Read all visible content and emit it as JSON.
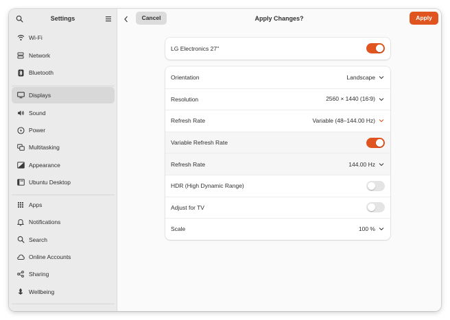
{
  "sidebar": {
    "title": "Settings",
    "search_icon": "search-icon",
    "menu_icon": "hamburger-menu-icon",
    "items": [
      {
        "label": "Wi-Fi",
        "icon": "wifi-icon"
      },
      {
        "label": "Network",
        "icon": "network-icon"
      },
      {
        "label": "Bluetooth",
        "icon": "bluetooth-icon"
      },
      {
        "label": "Displays",
        "icon": "display-icon",
        "selected": true
      },
      {
        "label": "Sound",
        "icon": "speaker-icon"
      },
      {
        "label": "Power",
        "icon": "power-icon"
      },
      {
        "label": "Multitasking",
        "icon": "multitasking-icon"
      },
      {
        "label": "Appearance",
        "icon": "appearance-icon"
      },
      {
        "label": "Ubuntu Desktop",
        "icon": "ubuntu-desktop-icon"
      },
      {
        "label": "Apps",
        "icon": "apps-grid-icon"
      },
      {
        "label": "Notifications",
        "icon": "bell-icon"
      },
      {
        "label": "Search",
        "icon": "search-icon"
      },
      {
        "label": "Online Accounts",
        "icon": "online-accounts-icon"
      },
      {
        "label": "Sharing",
        "icon": "share-icon"
      },
      {
        "label": "Wellbeing",
        "icon": "wellbeing-icon"
      }
    ]
  },
  "header": {
    "title": "Apply Changes?",
    "cancel_label": "Cancel",
    "apply_label": "Apply",
    "back_icon": "chevron-left-icon"
  },
  "monitor": {
    "name": "LG Electronics 27\"",
    "enabled": true
  },
  "settings": {
    "orientation": {
      "label": "Orientation",
      "value": "Landscape"
    },
    "resolution": {
      "label": "Resolution",
      "value": "2560 × 1440 (16∶9)"
    },
    "refresh_rate": {
      "label": "Refresh Rate",
      "value": "Variable (48–144.00 Hz)"
    },
    "variable_refresh": {
      "label": "Variable Refresh Rate",
      "enabled": true
    },
    "refresh_rate_fixed": {
      "label": "Refresh Rate",
      "value": "144.00 Hz"
    },
    "hdr": {
      "label": "HDR (High Dynamic Range)",
      "enabled": false
    },
    "adjust_tv": {
      "label": "Adjust for TV",
      "enabled": false
    },
    "scale": {
      "label": "Scale",
      "value": "100 %"
    }
  },
  "colors": {
    "accent": "#e05420",
    "sidebar_bg": "#ebebeb",
    "selected_bg": "#d8d8d8",
    "content_bg": "#fafafa"
  }
}
